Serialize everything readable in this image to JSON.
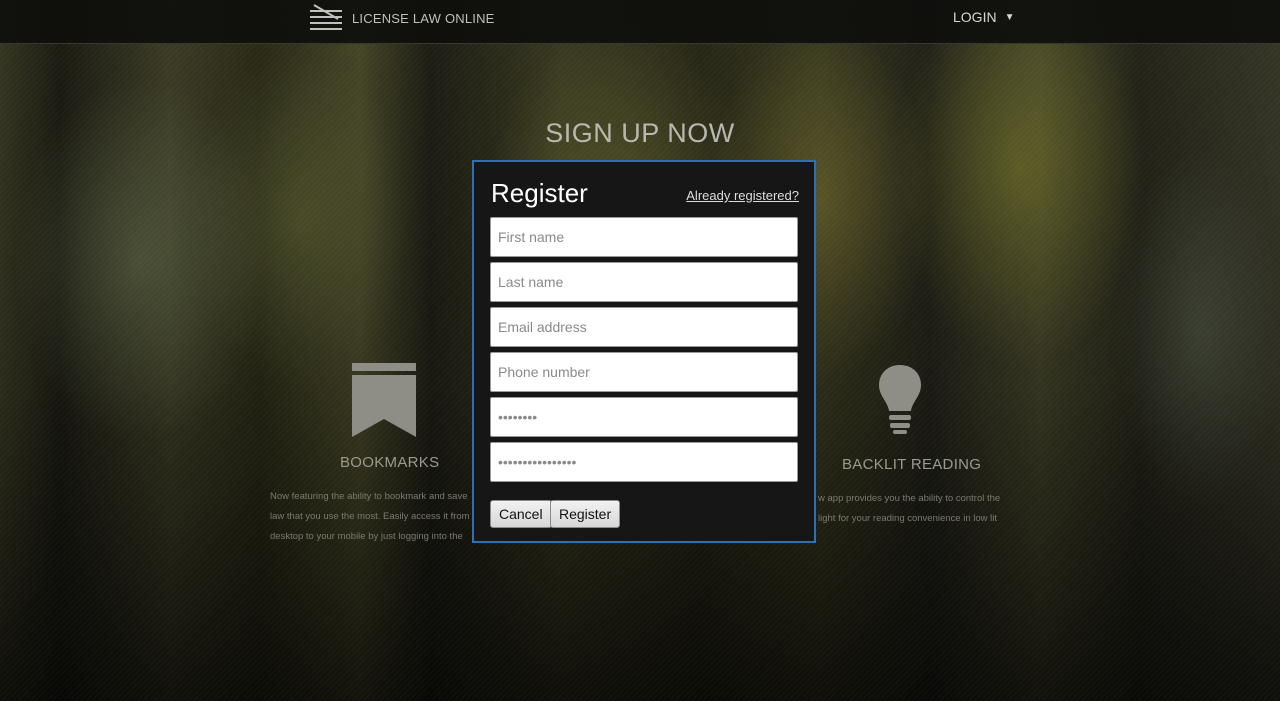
{
  "header": {
    "brand": "LICENSE LAW ONLINE",
    "login_label": "LOGIN",
    "login_caret": "▼"
  },
  "hero": {
    "title": "SIGN UP NOW"
  },
  "features": [
    {
      "icon": "bookmark-icon",
      "title": "BOOKMARKS",
      "lines": [
        "Now featuring the ability to bookmark and save",
        "law that you use the most. Easily access it from",
        "desktop to your mobile by just logging into the"
      ]
    },
    {
      "icon": "lightbulb-icon",
      "title": "BACKLIT READING",
      "lines": [
        "w app provides you the ability to control the",
        "light for your reading convenience in low lit"
      ]
    }
  ],
  "modal": {
    "title": "Register",
    "already_registered": "Already registered?",
    "fields": {
      "first_name": {
        "placeholder": "First name",
        "value": ""
      },
      "last_name": {
        "placeholder": "Last name",
        "value": ""
      },
      "email": {
        "placeholder": "Email address",
        "value": ""
      },
      "phone": {
        "placeholder": "Phone number",
        "value": ""
      },
      "password": {
        "placeholder": "••••••••",
        "value": ""
      },
      "password_confirm": {
        "placeholder": "••••••••••••••••",
        "value": ""
      }
    },
    "cancel_label": "Cancel",
    "register_label": "Register",
    "border_color": "#2f6fb3"
  }
}
